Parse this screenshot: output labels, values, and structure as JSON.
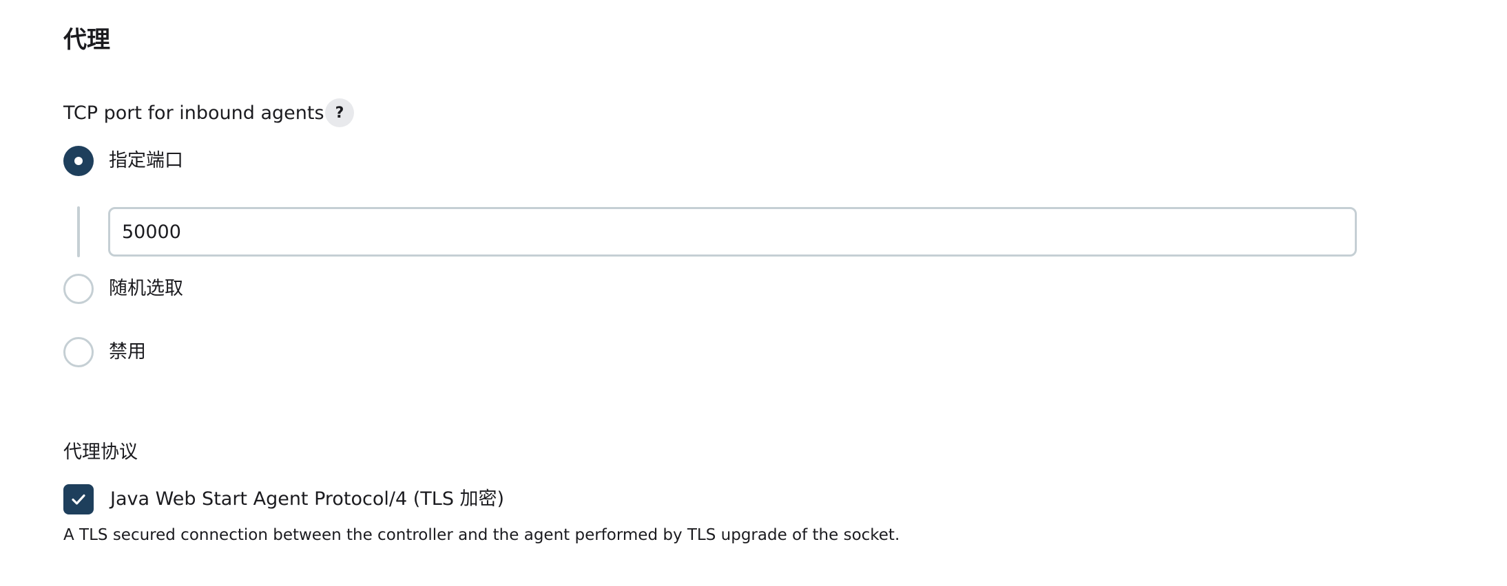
{
  "section": {
    "title": "代理"
  },
  "tcp_port": {
    "label": "TCP port for inbound agents",
    "help_label": "?",
    "options": [
      {
        "label": "指定端口",
        "checked": true
      },
      {
        "label": "随机选取",
        "checked": false
      },
      {
        "label": "禁用",
        "checked": false
      }
    ],
    "port_value": "50000"
  },
  "agent_protocols": {
    "title": "代理协议",
    "protocol_label": "Java Web Start Agent Protocol/4 (TLS 加密)",
    "protocol_checked": true,
    "description": "A TLS secured connection between the controller and the agent performed by TLS upgrade of the socket."
  },
  "colors": {
    "accent": "#1e3f5c",
    "border": "#c5cfd4",
    "help_bg": "#e8e9ec"
  }
}
